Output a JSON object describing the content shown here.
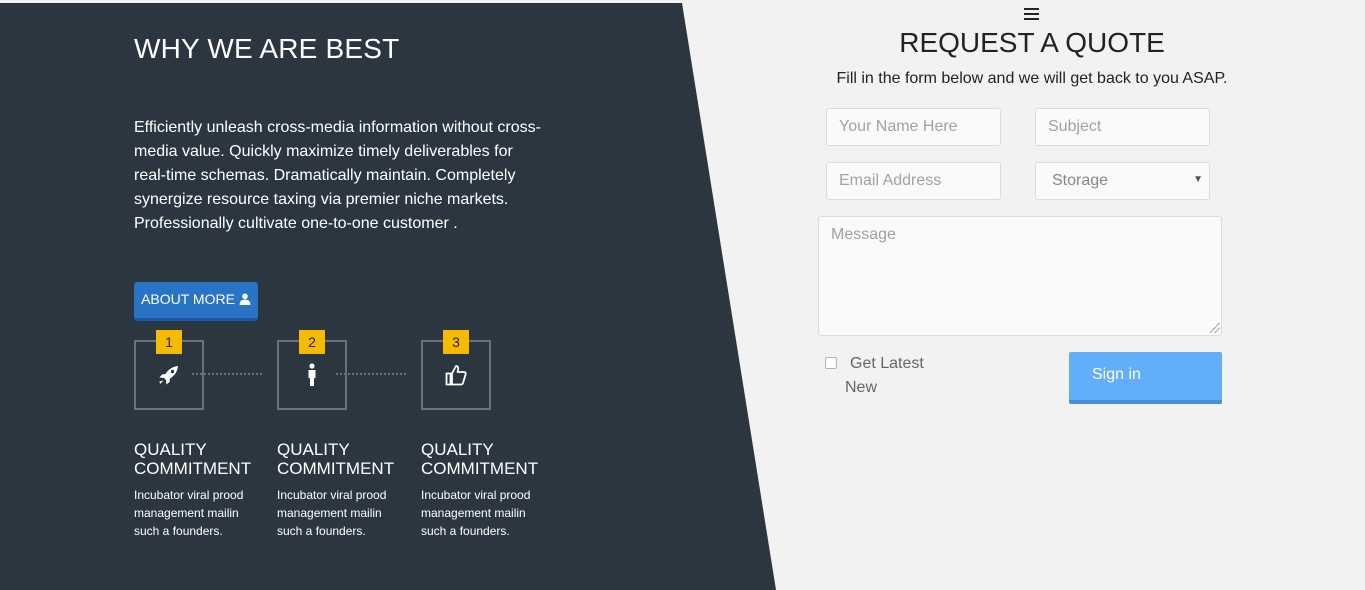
{
  "left": {
    "title": "WHY WE ARE BEST",
    "text": "Efficiently unleash cross-media information without cross-media value. Quickly maximize timely deliverables for real-time schemas. Dramatically maintain. Completely synergize resource taxing via premier niche markets. Professionally cultivate one-to-one customer .",
    "about_button": "ABOUT MORE",
    "features": [
      {
        "number": "1",
        "icon": "rocket-icon",
        "title_line1": "QUALITY",
        "title_line2": "COMMITMENT",
        "desc": "Incubator viral prood management mailin such a founders."
      },
      {
        "number": "2",
        "icon": "person-icon",
        "title_line1": "QUALITY",
        "title_line2": "COMMITMENT",
        "desc": "Incubator viral prood management mailin such a founders."
      },
      {
        "number": "3",
        "icon": "thumbs-up-icon",
        "title_line1": "QUALITY",
        "title_line2": "COMMITMENT",
        "desc": "Incubator viral prood management mailin such a founders."
      }
    ]
  },
  "form": {
    "title": "REQUEST A QUOTE",
    "subtitle": "Fill in the form below and we will get back to you ASAP.",
    "name_placeholder": "Your Name Here",
    "subject_placeholder": "Subject",
    "email_placeholder": "Email Address",
    "storage_selected": "Storage",
    "message_placeholder": "Message",
    "checkbox_label": "Get Latest New",
    "submit_label": "Sign in"
  },
  "colors": {
    "dark_panel": "#2c3640",
    "accent_yellow": "#f4bb00",
    "about_button": "#2a74c6",
    "sign_button": "#62aef9"
  }
}
